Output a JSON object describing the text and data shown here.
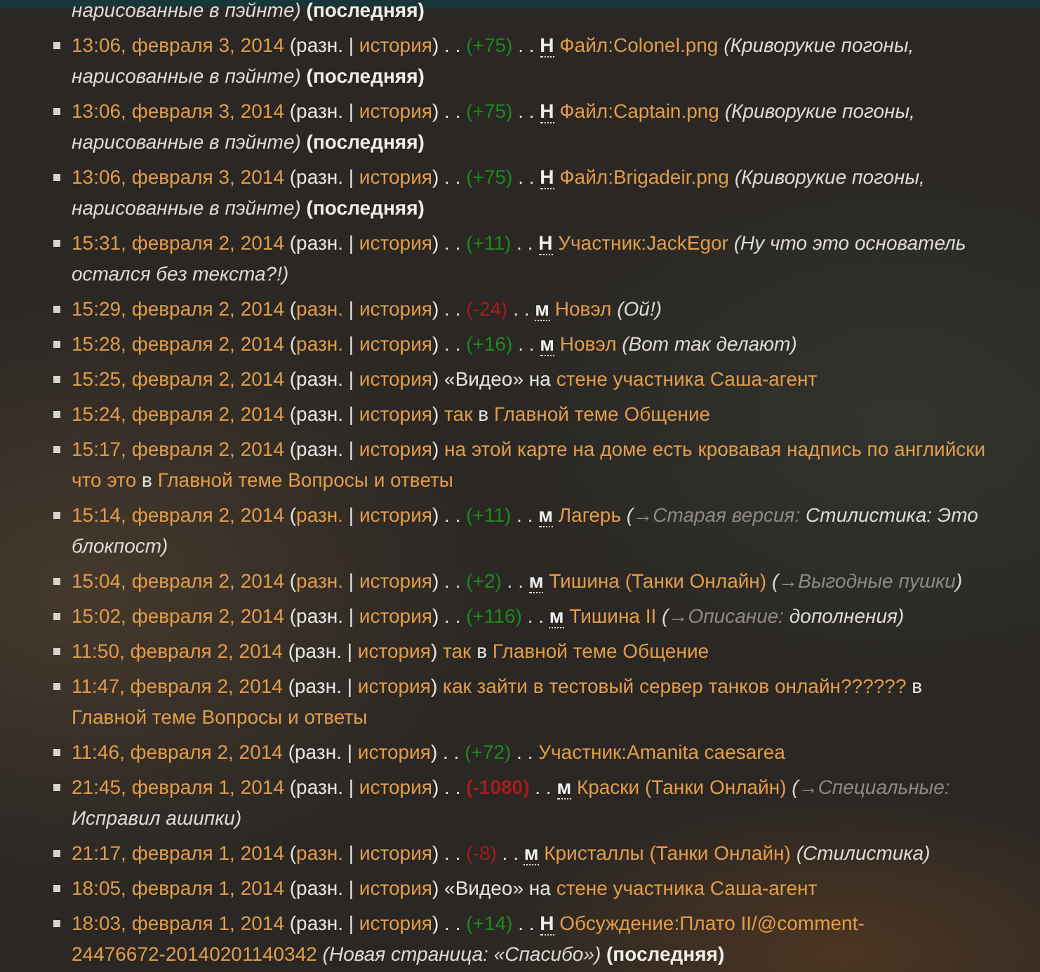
{
  "entries": [
    {
      "bullet": false,
      "lines": [
        [
          {
            "kind": "comment",
            "text": "нарисованные в пэйнте)"
          },
          {
            "kind": "latest",
            "text": " (последняя)"
          }
        ]
      ]
    },
    {
      "bullet": true,
      "lines": [
        [
          {
            "kind": "time",
            "text": "13:06, февраля 3, 2014"
          },
          {
            "kind": "text",
            "text": " (разн. | "
          },
          {
            "kind": "history",
            "text": "история"
          },
          {
            "kind": "text",
            "text": ") . . "
          },
          {
            "kind": "plus",
            "text": "(+75)"
          },
          {
            "kind": "text",
            "text": " . . "
          },
          {
            "kind": "flag",
            "text": "Н"
          },
          {
            "kind": "page",
            "text": " Файл:Colonel.png"
          },
          {
            "kind": "comment",
            "text": " (Криворукие погоны,"
          }
        ],
        [
          {
            "kind": "comment",
            "text": "нарисованные в пэйнте)"
          },
          {
            "kind": "latest",
            "text": " (последняя)"
          }
        ]
      ]
    },
    {
      "bullet": true,
      "lines": [
        [
          {
            "kind": "time",
            "text": "13:06, февраля 3, 2014"
          },
          {
            "kind": "text",
            "text": " (разн. | "
          },
          {
            "kind": "history",
            "text": "история"
          },
          {
            "kind": "text",
            "text": ") . . "
          },
          {
            "kind": "plus",
            "text": "(+75)"
          },
          {
            "kind": "text",
            "text": " . . "
          },
          {
            "kind": "flag",
            "text": "Н"
          },
          {
            "kind": "page",
            "text": " Файл:Captain.png"
          },
          {
            "kind": "comment",
            "text": " (Криворукие погоны,"
          }
        ],
        [
          {
            "kind": "comment",
            "text": "нарисованные в пэйнте)"
          },
          {
            "kind": "latest",
            "text": " (последняя)"
          }
        ]
      ]
    },
    {
      "bullet": true,
      "lines": [
        [
          {
            "kind": "time",
            "text": "13:06, февраля 3, 2014"
          },
          {
            "kind": "text",
            "text": " (разн. | "
          },
          {
            "kind": "history",
            "text": "история"
          },
          {
            "kind": "text",
            "text": ") . . "
          },
          {
            "kind": "plus",
            "text": "(+75)"
          },
          {
            "kind": "text",
            "text": " . . "
          },
          {
            "kind": "flag",
            "text": "Н"
          },
          {
            "kind": "page",
            "text": " Файл:Brigadeir.png"
          },
          {
            "kind": "comment",
            "text": " (Криворукие погоны,"
          }
        ],
        [
          {
            "kind": "comment",
            "text": "нарисованные в пэйнте)"
          },
          {
            "kind": "latest",
            "text": " (последняя)"
          }
        ]
      ]
    },
    {
      "bullet": true,
      "lines": [
        [
          {
            "kind": "time",
            "text": "15:31, февраля 2, 2014"
          },
          {
            "kind": "text",
            "text": " (разн. | "
          },
          {
            "kind": "history",
            "text": "история"
          },
          {
            "kind": "text",
            "text": ") . . "
          },
          {
            "kind": "plus",
            "text": "(+11)"
          },
          {
            "kind": "text",
            "text": " . . "
          },
          {
            "kind": "flag",
            "text": "Н"
          },
          {
            "kind": "page",
            "text": " Участник:JackEgor"
          },
          {
            "kind": "comment",
            "text": " (Ну что это основатель"
          }
        ],
        [
          {
            "kind": "comment",
            "text": "остался без текста?!)"
          }
        ]
      ]
    },
    {
      "bullet": true,
      "lines": [
        [
          {
            "kind": "time",
            "text": "15:29, февраля 2, 2014"
          },
          {
            "kind": "text",
            "text": " ("
          },
          {
            "kind": "diff",
            "text": "разн."
          },
          {
            "kind": "text",
            "text": " | "
          },
          {
            "kind": "history",
            "text": "история"
          },
          {
            "kind": "text",
            "text": ") . . "
          },
          {
            "kind": "minus",
            "text": "(-24)"
          },
          {
            "kind": "text",
            "text": " . . "
          },
          {
            "kind": "flag",
            "text": "м"
          },
          {
            "kind": "page",
            "text": " Новэл"
          },
          {
            "kind": "comment",
            "text": " (Ой!)"
          }
        ]
      ]
    },
    {
      "bullet": true,
      "lines": [
        [
          {
            "kind": "time",
            "text": "15:28, февраля 2, 2014"
          },
          {
            "kind": "text",
            "text": " ("
          },
          {
            "kind": "diff",
            "text": "разн."
          },
          {
            "kind": "text",
            "text": " | "
          },
          {
            "kind": "history",
            "text": "история"
          },
          {
            "kind": "text",
            "text": ") . . "
          },
          {
            "kind": "plus",
            "text": "(+16)"
          },
          {
            "kind": "text",
            "text": " . . "
          },
          {
            "kind": "flag",
            "text": "м"
          },
          {
            "kind": "page",
            "text": " Новэл"
          },
          {
            "kind": "comment",
            "text": " (Вот так делают)"
          }
        ]
      ]
    },
    {
      "bullet": true,
      "lines": [
        [
          {
            "kind": "time",
            "text": "15:25, февраля 2, 2014"
          },
          {
            "kind": "text",
            "text": " (разн. | "
          },
          {
            "kind": "history",
            "text": "история"
          },
          {
            "kind": "text",
            "text": ") «Видео» на "
          },
          {
            "kind": "page",
            "text": "стене участника Саша-агент"
          }
        ]
      ]
    },
    {
      "bullet": true,
      "lines": [
        [
          {
            "kind": "time",
            "text": "15:24, февраля 2, 2014"
          },
          {
            "kind": "text",
            "text": " (разн. | "
          },
          {
            "kind": "history",
            "text": "история"
          },
          {
            "kind": "text",
            "text": ") "
          },
          {
            "kind": "page",
            "text": "так"
          },
          {
            "kind": "text",
            "text": " в "
          },
          {
            "kind": "page",
            "text": "Главной теме Общение"
          }
        ]
      ]
    },
    {
      "bullet": true,
      "lines": [
        [
          {
            "kind": "time",
            "text": "15:17, февраля 2, 2014"
          },
          {
            "kind": "text",
            "text": " (разн. | "
          },
          {
            "kind": "history",
            "text": "история"
          },
          {
            "kind": "text",
            "text": ") "
          },
          {
            "kind": "page",
            "text": "на этой карте на доме есть кровавая надпись по английски"
          }
        ],
        [
          {
            "kind": "page",
            "text": "что это"
          },
          {
            "kind": "text",
            "text": " в "
          },
          {
            "kind": "page",
            "text": "Главной теме Вопросы и ответы"
          }
        ]
      ]
    },
    {
      "bullet": true,
      "lines": [
        [
          {
            "kind": "time",
            "text": "15:14, февраля 2, 2014"
          },
          {
            "kind": "text",
            "text": " ("
          },
          {
            "kind": "diff",
            "text": "разн."
          },
          {
            "kind": "text",
            "text": " | "
          },
          {
            "kind": "history",
            "text": "история"
          },
          {
            "kind": "text",
            "text": ") . . "
          },
          {
            "kind": "plus",
            "text": "(+11)"
          },
          {
            "kind": "text",
            "text": " . . "
          },
          {
            "kind": "flag",
            "text": "м"
          },
          {
            "kind": "page",
            "text": " Лагерь"
          },
          {
            "kind": "comment",
            "text": " ("
          },
          {
            "kind": "section",
            "text": "→Старая версия:"
          },
          {
            "kind": "comment",
            "text": " Стилистика: Это"
          }
        ],
        [
          {
            "kind": "comment",
            "text": "блокпост)"
          }
        ]
      ]
    },
    {
      "bullet": true,
      "lines": [
        [
          {
            "kind": "time",
            "text": "15:04, февраля 2, 2014"
          },
          {
            "kind": "text",
            "text": " ("
          },
          {
            "kind": "diff",
            "text": "разн."
          },
          {
            "kind": "text",
            "text": " | "
          },
          {
            "kind": "history",
            "text": "история"
          },
          {
            "kind": "text",
            "text": ") . . "
          },
          {
            "kind": "plus",
            "text": "(+2)"
          },
          {
            "kind": "text",
            "text": " . . "
          },
          {
            "kind": "flag",
            "text": "м"
          },
          {
            "kind": "page",
            "text": " Тишина (Танки Онлайн)"
          },
          {
            "kind": "comment",
            "text": " ("
          },
          {
            "kind": "section",
            "text": "→Выгодные пушки"
          },
          {
            "kind": "comment",
            "text": ")"
          }
        ]
      ]
    },
    {
      "bullet": true,
      "lines": [
        [
          {
            "kind": "time",
            "text": "15:02, февраля 2, 2014"
          },
          {
            "kind": "text",
            "text": " (разн. | "
          },
          {
            "kind": "history",
            "text": "история"
          },
          {
            "kind": "text",
            "text": ") . . "
          },
          {
            "kind": "plus",
            "text": "(+116)"
          },
          {
            "kind": "text",
            "text": " . . "
          },
          {
            "kind": "flag",
            "text": "м"
          },
          {
            "kind": "page",
            "text": " Тишина II"
          },
          {
            "kind": "comment",
            "text": " ("
          },
          {
            "kind": "section",
            "text": "→Описание:"
          },
          {
            "kind": "comment",
            "text": " дополнения)"
          }
        ]
      ]
    },
    {
      "bullet": true,
      "lines": [
        [
          {
            "kind": "time",
            "text": "11:50, февраля 2, 2014"
          },
          {
            "kind": "text",
            "text": " (разн. | "
          },
          {
            "kind": "history",
            "text": "история"
          },
          {
            "kind": "text",
            "text": ") "
          },
          {
            "kind": "page",
            "text": "так"
          },
          {
            "kind": "text",
            "text": " в "
          },
          {
            "kind": "page",
            "text": "Главной теме Общение"
          }
        ]
      ]
    },
    {
      "bullet": true,
      "lines": [
        [
          {
            "kind": "time",
            "text": "11:47, февраля 2, 2014"
          },
          {
            "kind": "text",
            "text": " (разн. | "
          },
          {
            "kind": "history",
            "text": "история"
          },
          {
            "kind": "text",
            "text": ") "
          },
          {
            "kind": "page",
            "text": "как зайти в тестовый сервер танков онлайн??????"
          },
          {
            "kind": "text",
            "text": " в"
          }
        ],
        [
          {
            "kind": "page",
            "text": "Главной теме Вопросы и ответы"
          }
        ]
      ]
    },
    {
      "bullet": true,
      "lines": [
        [
          {
            "kind": "time",
            "text": "11:46, февраля 2, 2014"
          },
          {
            "kind": "text",
            "text": " (разн. | "
          },
          {
            "kind": "history",
            "text": "история"
          },
          {
            "kind": "text",
            "text": ") . . "
          },
          {
            "kind": "plus",
            "text": "(+72)"
          },
          {
            "kind": "text",
            "text": " . . "
          },
          {
            "kind": "page",
            "text": "Участник:Amanita caesarea"
          }
        ]
      ]
    },
    {
      "bullet": true,
      "lines": [
        [
          {
            "kind": "time",
            "text": "21:45, февраля 1, 2014"
          },
          {
            "kind": "text",
            "text": " (разн. | "
          },
          {
            "kind": "history",
            "text": "история"
          },
          {
            "kind": "text",
            "text": ") . . "
          },
          {
            "kind": "bigminus",
            "text": "(-1080)"
          },
          {
            "kind": "text",
            "text": " . . "
          },
          {
            "kind": "flag",
            "text": "м"
          },
          {
            "kind": "page",
            "text": " Краски (Танки Онлайн)"
          },
          {
            "kind": "comment",
            "text": " ("
          },
          {
            "kind": "section",
            "text": "→Специальные:"
          }
        ],
        [
          {
            "kind": "comment",
            "text": "Исправил ашипки)"
          }
        ]
      ]
    },
    {
      "bullet": true,
      "lines": [
        [
          {
            "kind": "time",
            "text": "21:17, февраля 1, 2014"
          },
          {
            "kind": "text",
            "text": " ("
          },
          {
            "kind": "diff",
            "text": "разн."
          },
          {
            "kind": "text",
            "text": " | "
          },
          {
            "kind": "history",
            "text": "история"
          },
          {
            "kind": "text",
            "text": ") . . "
          },
          {
            "kind": "minus",
            "text": "(-8)"
          },
          {
            "kind": "text",
            "text": " . . "
          },
          {
            "kind": "flag",
            "text": "м"
          },
          {
            "kind": "page",
            "text": " Кристаллы (Танки Онлайн)"
          },
          {
            "kind": "comment",
            "text": " (Стилистика)"
          }
        ]
      ]
    },
    {
      "bullet": true,
      "lines": [
        [
          {
            "kind": "time",
            "text": "18:05, февраля 1, 2014"
          },
          {
            "kind": "text",
            "text": " (разн. | "
          },
          {
            "kind": "history",
            "text": "история"
          },
          {
            "kind": "text",
            "text": ") «Видео» на "
          },
          {
            "kind": "page",
            "text": "стене участника Саша-агент"
          }
        ]
      ]
    },
    {
      "bullet": true,
      "lines": [
        [
          {
            "kind": "time",
            "text": "18:03, февраля 1, 2014"
          },
          {
            "kind": "text",
            "text": " (разн. | "
          },
          {
            "kind": "history",
            "text": "история"
          },
          {
            "kind": "text",
            "text": ") . . "
          },
          {
            "kind": "plus",
            "text": "(+14)"
          },
          {
            "kind": "text",
            "text": " . . "
          },
          {
            "kind": "flag",
            "text": "Н"
          },
          {
            "kind": "page",
            "text": " Обсуждение:Плато II/@comment-"
          }
        ],
        [
          {
            "kind": "page",
            "text": "24476672-20140201140342"
          },
          {
            "kind": "comment",
            "text": " (Новая страница: «Спасибо»)"
          },
          {
            "kind": "latest",
            "text": " (последняя)"
          }
        ]
      ]
    }
  ]
}
